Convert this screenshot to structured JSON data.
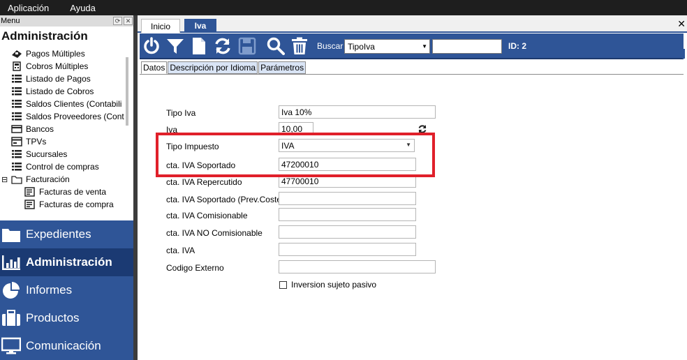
{
  "menubar": {
    "items": [
      "Aplicación",
      "Ayuda"
    ]
  },
  "left_panel": {
    "header_label": "Menu",
    "title": "Administración",
    "tree": [
      {
        "label": "Pagos Múltiples",
        "icon": "payments-icon",
        "indent": 0
      },
      {
        "label": "Cobros Múltiples",
        "icon": "collections-icon",
        "indent": 0
      },
      {
        "label": "Listado de Pagos",
        "icon": "list-icon",
        "indent": 0
      },
      {
        "label": "Listado de Cobros",
        "icon": "list-icon",
        "indent": 0
      },
      {
        "label": "Saldos Clientes (Contabili",
        "icon": "list-icon",
        "indent": 0
      },
      {
        "label": "Saldos Proveedores (Cont",
        "icon": "list-icon",
        "indent": 0
      },
      {
        "label": "Bancos",
        "icon": "bank-icon",
        "indent": 0
      },
      {
        "label": "TPVs",
        "icon": "pos-icon",
        "indent": 0
      },
      {
        "label": "Sucursales",
        "icon": "list-icon",
        "indent": 0
      },
      {
        "label": "Control de compras",
        "icon": "list-icon",
        "indent": 0
      },
      {
        "label": "Facturación",
        "icon": "folder-icon",
        "indent": 0,
        "expander": "⊟"
      },
      {
        "label": "Facturas de venta",
        "icon": "invoice-icon",
        "indent": 1
      },
      {
        "label": "Facturas de compra",
        "icon": "invoice-icon",
        "indent": 1
      }
    ],
    "nav": [
      {
        "label": "Expedientes",
        "icon": "folder-icon",
        "active": false
      },
      {
        "label": "Administración",
        "icon": "bar-chart-icon",
        "active": true
      },
      {
        "label": "Informes",
        "icon": "pie-chart-icon",
        "active": false
      },
      {
        "label": "Productos",
        "icon": "briefcase-icon",
        "active": false
      },
      {
        "label": "Comunicación",
        "icon": "monitor-icon",
        "active": false
      }
    ]
  },
  "tabs": [
    {
      "label": "Inicio",
      "active": false
    },
    {
      "label": "Iva",
      "active": true
    }
  ],
  "toolbar": {
    "search_label": "Buscar",
    "search_select": "TipoIva",
    "search_value": "",
    "id_label": "ID: 2"
  },
  "subtabs": [
    "Datos",
    "Descripción por Idioma",
    "Parámetros"
  ],
  "form": {
    "fields": [
      {
        "label": "Tipo Iva",
        "value": "Iva 10%"
      },
      {
        "label": "Iva",
        "value": "10,00"
      },
      {
        "label": "Tipo Impuesto",
        "value": "IVA"
      },
      {
        "label": "cta. IVA Soportado",
        "value": "47200010"
      },
      {
        "label": "cta. IVA Repercutido",
        "value": "47700010"
      },
      {
        "label": "cta. IVA Soportado (Prev.Coste)",
        "value": ""
      },
      {
        "label": "cta. IVA Comisionable",
        "value": ""
      },
      {
        "label": "cta. IVA NO Comisionable",
        "value": ""
      },
      {
        "label": "cta. IVA",
        "value": ""
      },
      {
        "label": "Codigo Externo",
        "value": ""
      }
    ],
    "checkbox_label": "Inversion sujeto pasivo",
    "checkbox_checked": false
  },
  "colors": {
    "accent": "#2f5597",
    "accent_dark": "#1b3a73",
    "highlight": "#e0202a"
  }
}
